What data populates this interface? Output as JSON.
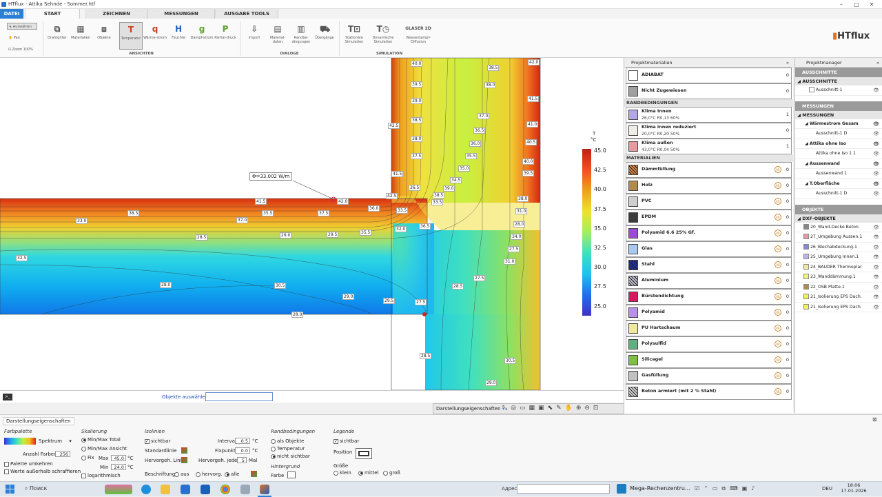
{
  "window": {
    "title": "HTflux - Attika Sehnde - Sommer.htf",
    "minimize": "–",
    "maximize": "□",
    "close": "✕"
  },
  "tabs": [
    "DATEI",
    "START",
    "ZEICHNEN",
    "MESSUNGEN",
    "AUSGABE TOOLS"
  ],
  "ribbon": {
    "tools": {
      "select": "Auswählen",
      "pan": "Pan",
      "zoom": "Zoom 100%"
    },
    "ansichten": [
      {
        "label": "Drahtgitter",
        "icon": "wireframe-icon"
      },
      {
        "label": "Materialien",
        "icon": "materials-icon"
      },
      {
        "label": "Objekte",
        "icon": "objects-icon"
      },
      {
        "label": "Temperatur",
        "icon": "temperature-icon"
      },
      {
        "label": "Wärme-strom",
        "icon": "heatflow-icon"
      },
      {
        "label": "Feuchte",
        "icon": "humidity-icon"
      },
      {
        "label": "Dampf-strom",
        "icon": "vaporflow-icon"
      },
      {
        "label": "Partial-druck",
        "icon": "partialpressure-icon"
      }
    ],
    "dialoge": [
      {
        "label": "Import",
        "icon": "import-icon"
      },
      {
        "label": "Material-daten",
        "icon": "materialdata-icon"
      },
      {
        "label": "Randbe-dingungen",
        "icon": "boundary-icon"
      },
      {
        "label": "Übergänge",
        "icon": "transitions-icon"
      }
    ],
    "simulation": [
      {
        "label": "Stationäre Simulation",
        "icon": "stationary-sim-icon"
      },
      {
        "label": "Dynamische Simulation",
        "icon": "dynamic-sim-icon"
      },
      {
        "label": "Wasserdampf-Diffusion",
        "icon": "glaser-icon",
        "badge": "GLASER 2D"
      }
    ],
    "groups": {
      "ansichten": "ANSICHTEN",
      "dialoge": "DIALOGE",
      "simulation": "SIMULATION"
    },
    "logo": "HTflux"
  },
  "canvas": {
    "flux_label": "Φ=33,002 W/m",
    "isoline_labels": [
      "40.0",
      "38.5",
      "42.0",
      "39.5",
      "38.0",
      "39.0",
      "41.5",
      "38.5",
      "37.0",
      "41.0",
      "42.5",
      "38.0",
      "36.5",
      "40.5",
      "36.0",
      "37.5",
      "35.5",
      "40.0",
      "35.0",
      "39.5",
      "34.5",
      "41.5",
      "39.0",
      "36.5",
      "42.5",
      "38.5",
      "41.5",
      "42.0",
      "33.5",
      "38.0",
      "36.0",
      "33.0",
      "38.5",
      "37.0",
      "35.5",
      "37.5",
      "33.5",
      "31.0",
      "32.0",
      "36.5",
      "28.0",
      "28.5",
      "29.0",
      "29.5",
      "35.5",
      "34.0",
      "27.5",
      "32.5",
      "31.0",
      "27.5",
      "28.0",
      "30.5",
      "28.5",
      "29.0",
      "29.5",
      "27.5",
      "28.0",
      "28.5",
      "30.5",
      "29.0"
    ],
    "objects_select_label": "Objekte auswählen"
  },
  "legend": {
    "title_t": "T",
    "unit": "°C",
    "ticks": [
      "45.0",
      "42.5",
      "40.0",
      "37.5",
      "35.0",
      "32.5",
      "30.0",
      "27.5",
      "25.0"
    ]
  },
  "view_toolbar": {
    "label": "Darstellungseigenschaften"
  },
  "projektmaterialien": {
    "title": "Projektmaterialien",
    "top_rows": [
      {
        "name": "ADIABAT",
        "count": "0",
        "color": "#ffffff"
      },
      {
        "name": "Nicht Zugewiesen",
        "count": "0",
        "color": "#a0a0a0"
      }
    ],
    "randbedingungen_title": "RANDBEDINGUNGEN",
    "randbedingungen": [
      {
        "name": "Klima Innen",
        "sub": "26,0°C R0,13 60%",
        "count": "1",
        "color": "#b3a6e8"
      },
      {
        "name": "Klima innen reduziert",
        "sub": "20,0°C R0,20 50%",
        "count": "0",
        "color": "#f0ece8"
      },
      {
        "name": "Klima außen",
        "sub": "43,0°C R0,04 50%",
        "count": "1",
        "color": "#e89aa0"
      }
    ],
    "materialien_title": "MATERIALIEN",
    "materialien": [
      {
        "name": "Dämmfüllung",
        "count": "0",
        "color": "#d08040",
        "hatch": true
      },
      {
        "name": "Holz",
        "count": "0",
        "color": "#b08c4c"
      },
      {
        "name": "PVC",
        "count": "0",
        "color": "#cfcfcf"
      },
      {
        "name": "EPDM",
        "count": "0",
        "color": "#3c3c3c"
      },
      {
        "name": "Polyamid 6.6 25% Gf.",
        "count": "0",
        "color": "#9c4ad8"
      },
      {
        "name": "Glas",
        "count": "0",
        "color": "#a8c8f0"
      },
      {
        "name": "Stahl",
        "count": "0",
        "color": "#2030a0",
        "hatch": true
      },
      {
        "name": "Aluminium",
        "count": "0",
        "color": "#b8b8c8",
        "hatch": true
      },
      {
        "name": "Bürstendichtung",
        "count": "0",
        "color": "#d81860"
      },
      {
        "name": "Polyamid",
        "count": "0",
        "color": "#b890e8"
      },
      {
        "name": "PU Hartschaum",
        "count": "0",
        "color": "#f0e8a0"
      },
      {
        "name": "Polysulfid",
        "count": "0",
        "color": "#60b080"
      },
      {
        "name": "Silicagel",
        "count": "0",
        "color": "#80c040"
      },
      {
        "name": "Gasfüllung",
        "count": "0",
        "color": "#c0c0c0"
      },
      {
        "name": "Beton armiert (mit 2 % Stahl)",
        "count": "0",
        "color": "#d0d0d0",
        "hatch": true
      }
    ]
  },
  "projektmanager": {
    "title": "Projektmanager",
    "ausschnitte_title": "AUSSCHNITTE",
    "ausschnitte_sub": "AUSSCHNITTE",
    "ausschnitte": [
      "Ausschnitt-1"
    ],
    "messungen_title": "MESSUNGEN",
    "messungen_sub": "MESSUNGEN",
    "messungen": [
      {
        "name": "Wärmestrom Gesam",
        "child": "Ausschnitt-1 D"
      },
      {
        "name": "Attika ohne Iso",
        "child": "Attika ohne Iso 1 1"
      },
      {
        "name": "Aussenwand",
        "child": "Aussenwand 1"
      },
      {
        "name": "T.Oberfläche",
        "child": "Ausschnitt-1 D"
      }
    ],
    "objekte_title": "OBJEKTE",
    "dxf_title": "DXF-OBJEKTE",
    "dxf": [
      {
        "name": "20_Wand-Decke Beton.",
        "color": "#888888"
      },
      {
        "name": "27_Umgebung Aussen.1",
        "color": "#e89aa0"
      },
      {
        "name": "26_Blechabdeckung.1",
        "color": "#8888d8"
      },
      {
        "name": "25_Umgebung Innen.1",
        "color": "#c0b0f0"
      },
      {
        "name": "24_BAUDER Thermoplar",
        "color": "#f0e8a0"
      },
      {
        "name": "23_Wanddämmung.1",
        "color": "#f0f080"
      },
      {
        "name": "22_OSB Platte.1",
        "color": "#b08c4c"
      },
      {
        "name": "21_Isolierung EPS Dach.",
        "color": "#f0f060"
      },
      {
        "name": "21_Isolierung EPS Dach.",
        "color": "#f0f060"
      }
    ]
  },
  "bottom": {
    "tab": "Darstellungseigenschaften",
    "farbpalette": {
      "title": "Farbpalette",
      "palette": "Spektrum",
      "anzahl_label": "Anzahl Farben",
      "anzahl": "256",
      "umkehren": "Palette umkehren",
      "schraffieren": "Werte außerhalb schraffieren"
    },
    "skalierung": {
      "title": "Skalierung",
      "opt1": "Min/Max Total",
      "opt2": "Min/Max Ansicht",
      "opt3": "Fix",
      "max_label": "Max",
      "max": "45.0",
      "min_label": "Min",
      "min": "24.0",
      "unit": "°C",
      "log": "logarithmisch"
    },
    "isolinien": {
      "title": "Isolinien",
      "sichtbar": "sichtbar",
      "interval_label": "Interval",
      "interval": "0.5",
      "standardlinie": "Standardlinie",
      "fixpunkt_label": "Fixpunkt",
      "fixpunkt": "0.0",
      "hervorgeh_linie": "Hervorgeh. Linie",
      "hervorgeh_jedes": "Hervorgeh. jedes",
      "jedes": "5",
      "mal": "Mal",
      "unit": "°C",
      "beschriftung": "Beschriftung:",
      "b_aus": "aus",
      "b_hervorg": "hervorg.",
      "b_alle": "alle"
    },
    "randbedingungen": {
      "title": "Randbedingungen",
      "o1": "als Objekte",
      "o2": "Temperatur",
      "o3": "nicht sichtbar"
    },
    "hintergrund": {
      "title": "Hintergrund",
      "farbe": "Farbe"
    },
    "legende": {
      "title": "Legende",
      "sichtbar": "sichtbar",
      "position": "Position",
      "groesse": "Größe",
      "g1": "klein",
      "g2": "mittel",
      "g3": "groß"
    }
  },
  "taskbar": {
    "search": "Поиск",
    "address_label": "Адрес",
    "app": "Mega-Rechenzentru...",
    "lang": "DEU",
    "time": "18:06",
    "date": "17.01.2026"
  }
}
